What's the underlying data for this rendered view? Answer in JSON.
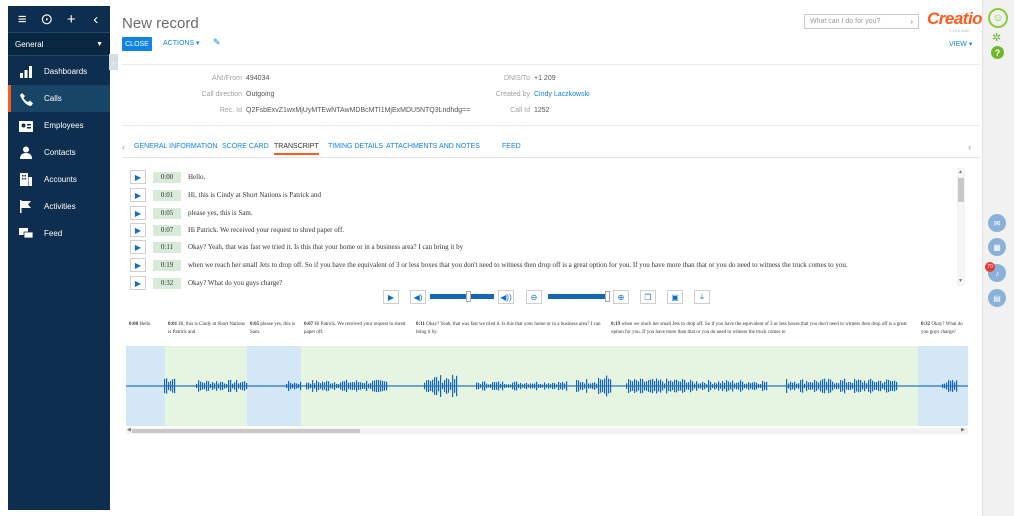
{
  "nav": {
    "top_icons": [
      "menu-icon",
      "play-circle-icon",
      "plus-icon",
      "chevron-left-icon"
    ],
    "section": "General",
    "items": [
      {
        "label": "Dashboards",
        "icon": "bar-chart-icon",
        "active": false
      },
      {
        "label": "Calls",
        "icon": "phone-icon",
        "active": true
      },
      {
        "label": "Employees",
        "icon": "id-card-icon",
        "active": false
      },
      {
        "label": "Contacts",
        "icon": "person-icon",
        "active": false
      },
      {
        "label": "Accounts",
        "icon": "building-icon",
        "active": false
      },
      {
        "label": "Activities",
        "icon": "flag-icon",
        "active": false
      },
      {
        "label": "Feed",
        "icon": "chat-icon",
        "active": false
      }
    ]
  },
  "header": {
    "title": "New record",
    "close_label": "CLOSE",
    "actions_label": "ACTIONS ▾",
    "search_placeholder": "What can I do for you?",
    "logo": "Creatio",
    "logo_sub": "7.15.0.4467",
    "view_label": "VIEW ▾"
  },
  "record": {
    "ani_from_label": "ANI/From",
    "ani_from_value": "494034",
    "dnis_to_label": "DNIS/To",
    "dnis_to_value": "+1 209",
    "call_direction_label": "Call direction",
    "call_direction_value": "Outgoing",
    "created_by_label": "Created by",
    "created_by_value": "Cindy Laczkowski",
    "rec_id_label": "Rec. Id",
    "rec_id_value": "Q2FsbExvZ1wxMjUyMTEwNTAwMDBcMTI1MjExMDU5NTQ3Lndhdg==",
    "call_id_label": "Call Id",
    "call_id_value": "1252"
  },
  "tabs": [
    "GENERAL INFORMATION",
    "SCORE CARD",
    "TRANSCRIPT",
    "TIMING DETAILS",
    "ATTACHMENTS AND NOTES",
    "FEED"
  ],
  "transcript": [
    {
      "time": "0:00",
      "text": "Hello."
    },
    {
      "time": "0:01",
      "text": "Hi, this is Cindy at Short Nations is Patrick and"
    },
    {
      "time": "0:05",
      "text": "please yes, this is Sam."
    },
    {
      "time": "0:07",
      "text": "Hi Patrick. We received your request to shred paper off."
    },
    {
      "time": "0:11",
      "text": "Okay? Yeah, that was fast we tried it. Is this that your home or in a business area? I can bring it by"
    },
    {
      "time": "0:19",
      "text": "when we reach her small Jets to drop off. So if you have the equivalent of 3 or less boxes that you don't need to witness then drop off is a great option for you. If you have more than that or you do need to witness the truck comes to you."
    },
    {
      "time": "0:32",
      "text": "Okay? What do you guys charge?"
    }
  ],
  "wave_segments": [
    {
      "time": "0:00",
      "text": "Hello",
      "color": "#d3e7f5"
    },
    {
      "time": "0:01",
      "text": "Hi, this is Cindy at Short Nations is Patrick and",
      "color": "#e6f5e1"
    },
    {
      "time": "0:05",
      "text": "please yes, this is Sam.",
      "color": "#d3e7f5"
    },
    {
      "time": "0:07",
      "text": "Hi Patrick. We received your request to shred paper off.",
      "color": "#e6f5e1"
    },
    {
      "time": "0:11",
      "text": "Okay? Yeah, that was fast we tried it. Is this that your home or in a business area? I can bring it by",
      "color": "#e6f5e1"
    },
    {
      "time": "0:19",
      "text": "when we reach her small Jets to drop off. So if you have the equivalent of 3 or less boxes that you don't need to witness then drop off is a great option for you. If you have more than that or you do need to witness the truck comes to",
      "color": "#e6f5e1"
    },
    {
      "time": "0:32",
      "text": "Okay? What do you guys charge?",
      "color": "#d3e7f5"
    }
  ],
  "player": {
    "volume_level": 0.6,
    "zoom_level": 0.95,
    "icons": [
      "play-icon",
      "volume-down-icon",
      "volume-up-icon",
      "zoom-out-icon",
      "zoom-in-icon",
      "copy-icon",
      "save-icon",
      "download-icon"
    ]
  },
  "rail": {
    "badge": "70",
    "icons": [
      "user-icon",
      "gear-icon",
      "help-icon",
      "mail-icon",
      "chat-bubbles-icon",
      "bell-icon",
      "phone-book-icon"
    ]
  },
  "colors": {
    "nav_bg": "#0d2e4e",
    "accent": "#0e84e5",
    "brand": "#ff5a1f",
    "waveform": "#1566b7",
    "green": "#6fb829"
  }
}
